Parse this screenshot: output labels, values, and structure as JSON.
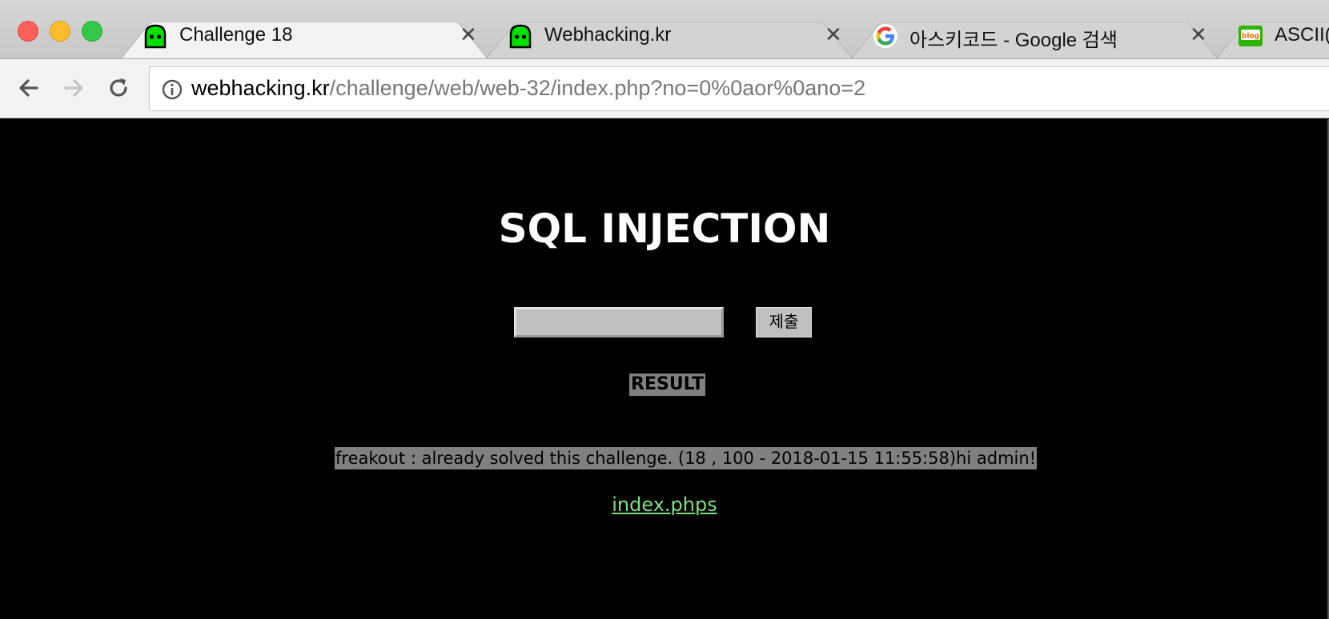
{
  "window": {
    "controls": [
      "close",
      "minimize",
      "zoom"
    ]
  },
  "tabs": [
    {
      "title": "Challenge 18",
      "icon": "webhacking-ghost-icon",
      "active": true
    },
    {
      "title": "Webhacking.kr",
      "icon": "webhacking-ghost-icon",
      "active": false
    },
    {
      "title": "아스키코드 - Google 검색",
      "icon": "google-g-icon",
      "active": false
    },
    {
      "title": "ASCII(",
      "icon": "blog-icon",
      "active": false
    }
  ],
  "toolbar": {
    "url_host": "webhacking.kr",
    "url_path": "/challenge/web/web-32/index.php?no=0%0aor%0ano=2"
  },
  "page": {
    "heading": "SQL INJECTION",
    "input_value": "",
    "submit_label": "제출",
    "result_label": "RESULT",
    "result_text": "freakout : already solved this challenge. (18 , 100 - 2018-01-15 11:55:58)hi admin!",
    "source_link": "index.phps"
  },
  "colors": {
    "page_bg": "#000000",
    "link": "#7ee07e",
    "highlight": "#808080"
  }
}
